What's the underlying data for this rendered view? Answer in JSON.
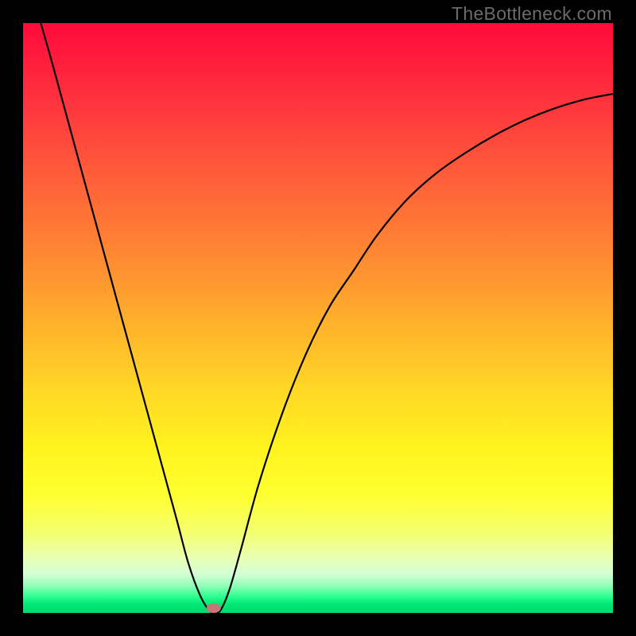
{
  "watermark": "TheBottleneck.com",
  "chart_data": {
    "type": "line",
    "title": "",
    "xlabel": "",
    "ylabel": "",
    "xlim": [
      0,
      100
    ],
    "ylim": [
      0,
      100
    ],
    "grid": false,
    "series": [
      {
        "name": "curve",
        "color": "#000000",
        "x": [
          3,
          5,
          8,
          11,
          14,
          17,
          20,
          23,
          26,
          28,
          30,
          31.5,
          32.5,
          33.5,
          35,
          37,
          40,
          44,
          48,
          52,
          56,
          60,
          65,
          70,
          75,
          80,
          85,
          90,
          95,
          100
        ],
        "y": [
          100,
          93,
          82,
          71,
          60,
          49,
          38,
          27,
          16,
          8.5,
          3,
          0.5,
          0,
          0.5,
          4,
          11,
          22,
          34,
          44,
          52,
          58,
          64,
          70,
          74.5,
          78,
          81,
          83.5,
          85.5,
          87,
          88
        ]
      }
    ],
    "marker": {
      "x": 32.3,
      "y": 0.8,
      "color": "#c77676"
    },
    "background_gradient": {
      "stops": [
        {
          "offset": 0.0,
          "color": "#ff0a3a"
        },
        {
          "offset": 0.12,
          "color": "#ff2f3e"
        },
        {
          "offset": 0.25,
          "color": "#ff5a3a"
        },
        {
          "offset": 0.38,
          "color": "#ff8433"
        },
        {
          "offset": 0.5,
          "color": "#ffae2c"
        },
        {
          "offset": 0.62,
          "color": "#ffd726"
        },
        {
          "offset": 0.72,
          "color": "#fff31e"
        },
        {
          "offset": 0.8,
          "color": "#ffff30"
        },
        {
          "offset": 0.86,
          "color": "#f5ff6a"
        },
        {
          "offset": 0.905,
          "color": "#eaffb0"
        },
        {
          "offset": 0.935,
          "color": "#d2ffd6"
        },
        {
          "offset": 0.955,
          "color": "#8cffb5"
        },
        {
          "offset": 0.972,
          "color": "#2dff8f"
        },
        {
          "offset": 0.985,
          "color": "#00e877"
        },
        {
          "offset": 1.0,
          "color": "#00d96e"
        }
      ]
    }
  }
}
